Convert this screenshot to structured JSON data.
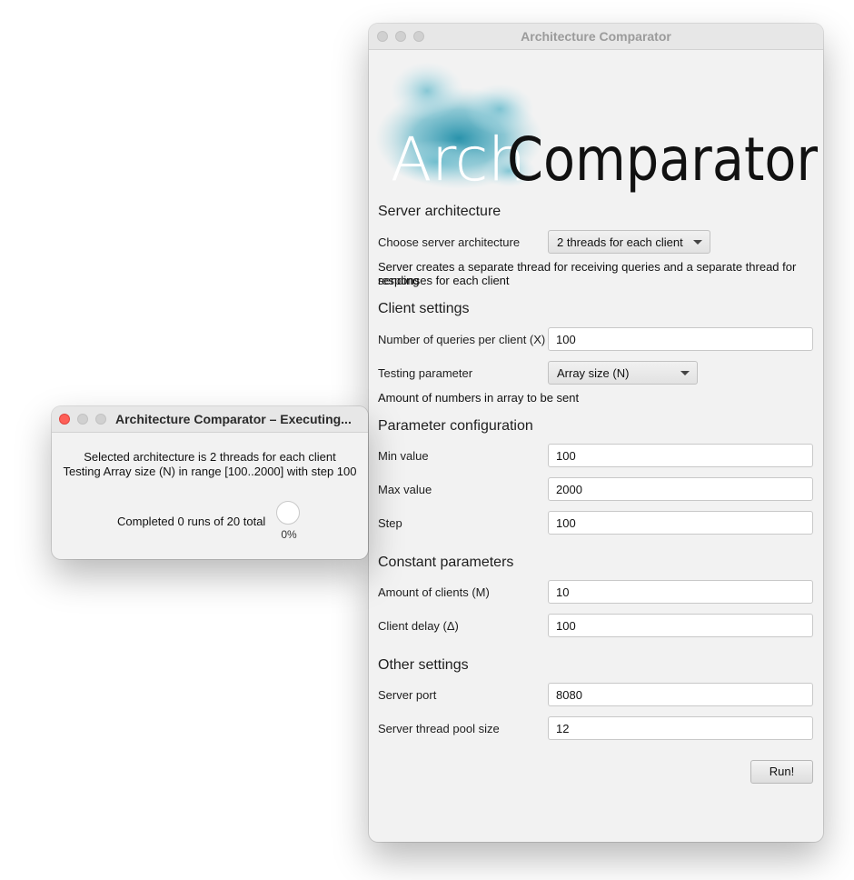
{
  "main_window": {
    "title": "Architecture Comparator",
    "logo": {
      "text_light": "Arch",
      "text_dark": "Comparator"
    },
    "server_architecture": {
      "heading": "Server architecture",
      "choose_label": "Choose server architecture",
      "selected": "2 threads for each client",
      "description_line1": "Server creates a separate thread for receiving queries and a separate thread for sending",
      "description_line2": "responses for each client"
    },
    "client_settings": {
      "heading": "Client settings",
      "queries_label": "Number of queries per client (X)",
      "queries_value": "100",
      "testing_label": "Testing parameter",
      "testing_selected": "Array size (N)",
      "testing_description": "Amount of numbers in array to be sent"
    },
    "parameter_configuration": {
      "heading": "Parameter configuration",
      "min_label": "Min value",
      "min_value": "100",
      "max_label": "Max value",
      "max_value": "2000",
      "step_label": "Step",
      "step_value": "100"
    },
    "constant_parameters": {
      "heading": "Constant parameters",
      "clients_label": "Amount of clients (M)",
      "clients_value": "10",
      "delay_label": "Client delay (Δ)",
      "delay_value": "100"
    },
    "other_settings": {
      "heading": "Other settings",
      "port_label": "Server port",
      "port_value": "8080",
      "pool_label": "Server thread pool size",
      "pool_value": "12"
    },
    "run_label": "Run!"
  },
  "dialog": {
    "title": "Architecture Comparator – Executing...",
    "line1": "Selected architecture is 2 threads for each client",
    "line2": "Testing Array size (N) in range [100..2000] with step 100",
    "completed_text": "Completed 0 runs of 20 total",
    "progress_percent": "0%",
    "progress_fraction": 0
  },
  "colors": {
    "logo_accent": "#3a9fb5",
    "close_button": "#fe5f57"
  }
}
